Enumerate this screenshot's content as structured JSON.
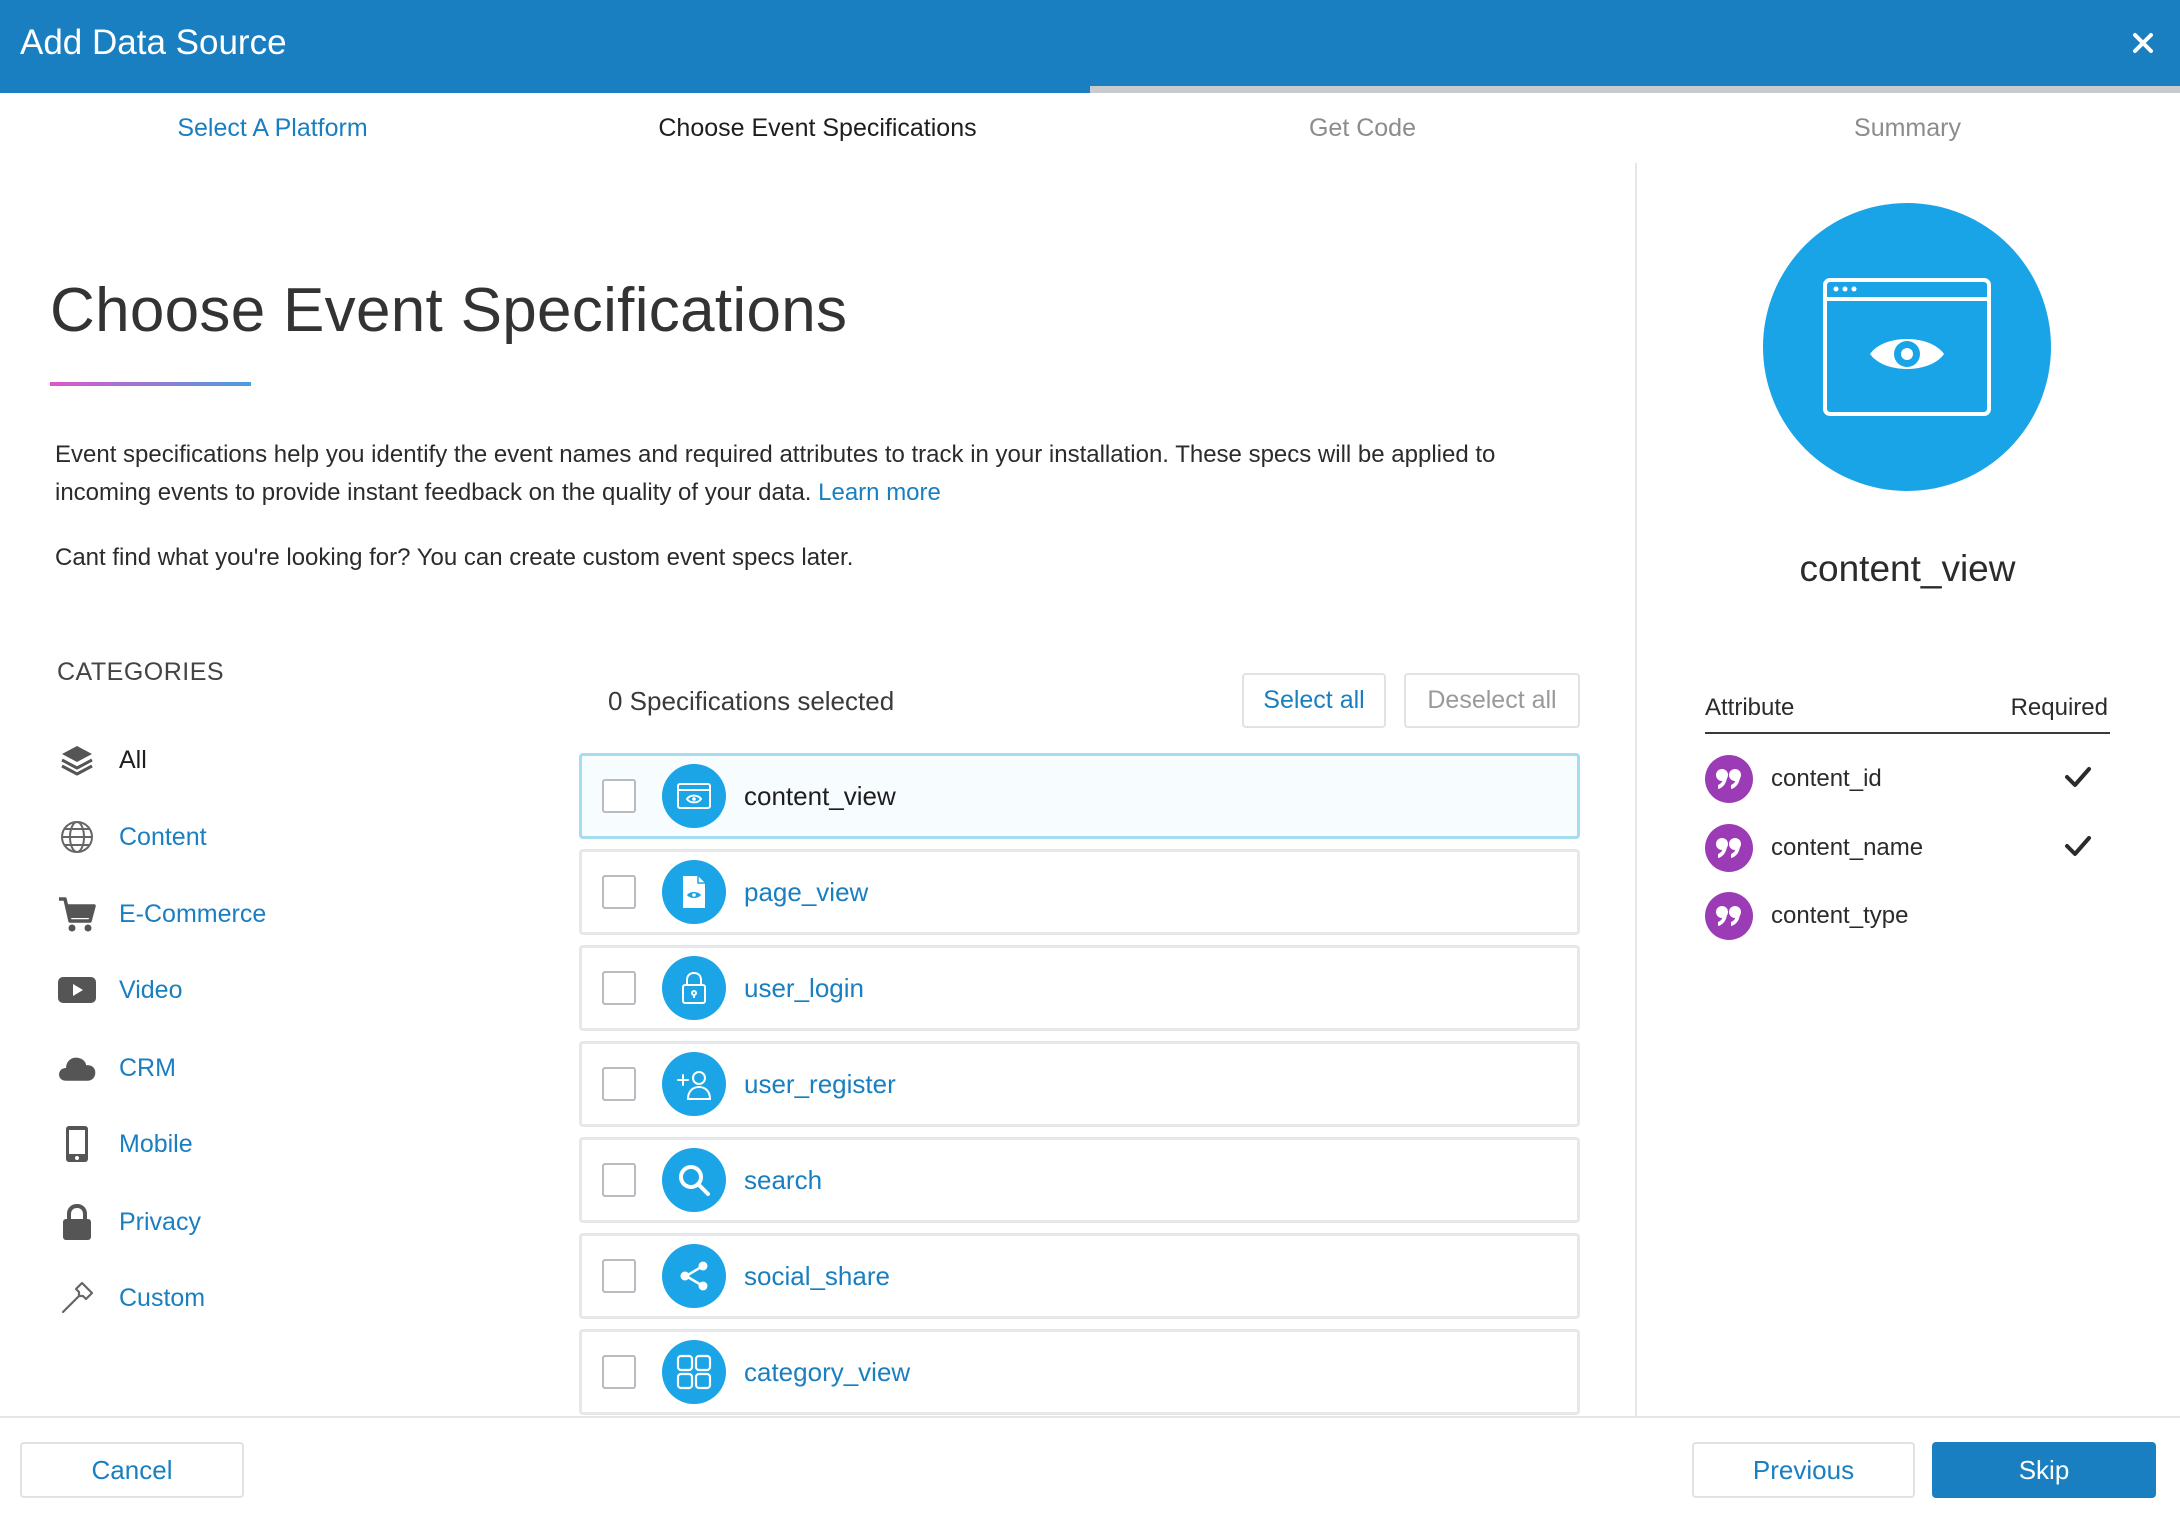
{
  "header": {
    "title": "Add Data Source",
    "close_icon": "close-icon"
  },
  "progress": {
    "fraction": 0.5
  },
  "steps": [
    {
      "label": "Select A Platform",
      "state": "done"
    },
    {
      "label": "Choose Event Specifications",
      "state": "active"
    },
    {
      "label": "Get Code",
      "state": "future"
    },
    {
      "label": "Summary",
      "state": "future"
    }
  ],
  "main": {
    "title": "Choose Event Specifications",
    "description": "Event specifications help you identify the event names and required attributes to track in your installation. These specs will be applied to incoming events to provide instant feedback on the quality of your data.",
    "learn_more": "Learn more",
    "note": "Cant find what you're looking for? You can create custom event specs later."
  },
  "categories": {
    "heading": "CATEGORIES",
    "items": [
      {
        "label": "All",
        "icon": "layers-icon",
        "active": true
      },
      {
        "label": "Content",
        "icon": "globe-icon"
      },
      {
        "label": "E-Commerce",
        "icon": "cart-icon"
      },
      {
        "label": "Video",
        "icon": "video-icon"
      },
      {
        "label": "CRM",
        "icon": "cloud-icon"
      },
      {
        "label": "Mobile",
        "icon": "mobile-icon"
      },
      {
        "label": "Privacy",
        "icon": "lock-icon"
      },
      {
        "label": "Custom",
        "icon": "hammer-icon"
      }
    ]
  },
  "specs": {
    "count_text": "0 Specifications selected",
    "select_all": "Select all",
    "deselect_all": "Deselect all",
    "items": [
      {
        "label": "content_view",
        "icon": "browser-eye-icon",
        "selected": true
      },
      {
        "label": "page_view",
        "icon": "page-eye-icon"
      },
      {
        "label": "user_login",
        "icon": "padlock-icon"
      },
      {
        "label": "user_register",
        "icon": "add-user-icon"
      },
      {
        "label": "search",
        "icon": "search-icon"
      },
      {
        "label": "social_share",
        "icon": "share-icon"
      },
      {
        "label": "category_view",
        "icon": "grid-icon"
      }
    ]
  },
  "detail": {
    "name": "content_view",
    "icon": "browser-eye-icon",
    "attribute_header": "Attribute",
    "required_header": "Required",
    "attributes": [
      {
        "name": "content_id",
        "required": true
      },
      {
        "name": "content_name",
        "required": true
      },
      {
        "name": "content_type",
        "required": false
      }
    ]
  },
  "footer": {
    "cancel": "Cancel",
    "previous": "Previous",
    "skip": "Skip"
  },
  "colors": {
    "primary": "#1a7fc1",
    "icon_blue": "#1ba4e6",
    "attr_purple": "#9c3bb6"
  }
}
